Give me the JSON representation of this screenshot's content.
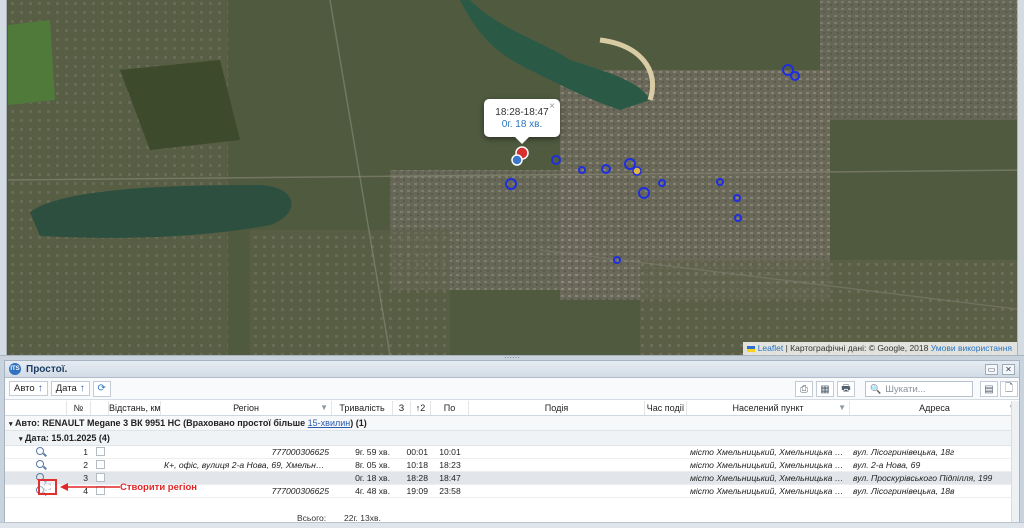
{
  "map": {
    "popup": {
      "time_range": "18:28-18:47",
      "duration": "0г. 18 хв.",
      "close": "×"
    },
    "attribution": {
      "leaflet": "Leaflet",
      "separator": " | Картографічні дані: © Google, 2018 ",
      "terms": "Умови використання"
    }
  },
  "panel": {
    "title": "Простої.",
    "logo_text": "ITS",
    "window_buttons": [
      "▭",
      "✕"
    ],
    "toolbar": {
      "sort_auto": "Авто",
      "sort_date": "Дата",
      "sort_arrow": "↑",
      "search_placeholder": "Шукати..."
    },
    "columns": [
      "№",
      "Відстань, км",
      "Регіон",
      "Тривалість",
      "З",
      "↑2",
      "По",
      "Подія",
      "Час події",
      "Населений пункт",
      "Адреса"
    ],
    "group_auto": {
      "prefix": "Авто: RENAULT Megane 3 ВК 9951 НС (Враховано простої більше ",
      "link": "15-хвилин",
      "suffix": ") (1)"
    },
    "group_date": "Дата: 15.01.2025 (4)",
    "rows": [
      {
        "n": "1",
        "region": "777000306625",
        "duration": "9г. 59 хв.",
        "from": "00:01",
        "to": "10:01",
        "city": "місто Хмельницький, Хмельницька область",
        "address": "вул. Лісогринівецька, 18г"
      },
      {
        "n": "2",
        "region": "К+, офіс, вулиця 2-а Нова, 69, Хмельницький…",
        "duration": "8г. 05 хв.",
        "from": "10:18",
        "to": "18:23",
        "city": "місто Хмельницький, Хмельницька область",
        "address": "вул. 2-а Нова, 69"
      },
      {
        "n": "3",
        "region": "",
        "duration": "0г. 18 хв.",
        "from": "18:28",
        "to": "18:47",
        "city": "місто Хмельницький, Хмельницька область",
        "address": "вул. Проскурівського Підпілля, 199"
      },
      {
        "n": "4",
        "region": "777000306625",
        "duration": "4г. 48 хв.",
        "from": "19:09",
        "to": "23:58",
        "city": "місто Хмельницький, Хмельницька область",
        "address": "вул. Лісогринівецька, 18в"
      }
    ],
    "total_label": "Всього:",
    "total_value": "22г. 13хв."
  },
  "annotation": {
    "callout": "Створити регіон",
    "callout_color": "#e02626"
  },
  "colors": {
    "accent": "#2a74c0",
    "marker": "#1f2fe0"
  }
}
